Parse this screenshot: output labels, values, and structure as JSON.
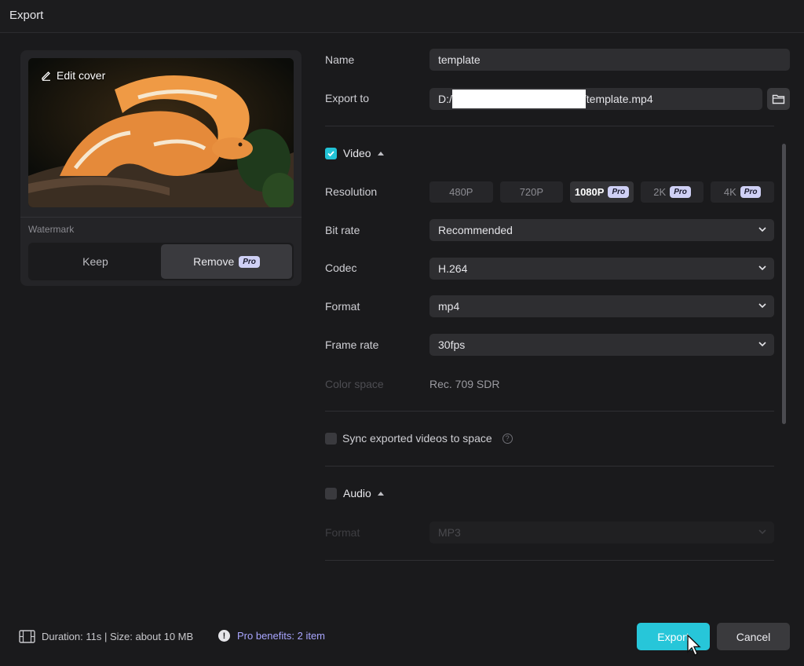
{
  "window": {
    "title": "Export"
  },
  "cover": {
    "edit_label": "Edit cover"
  },
  "watermark": {
    "label": "Watermark",
    "keep_label": "Keep",
    "remove_label": "Remove",
    "pro_badge": "Pro"
  },
  "form": {
    "name_label": "Name",
    "name_value": "template",
    "export_to_label": "Export to",
    "path_prefix": "D:/",
    "path_suffix": "/template.mp4"
  },
  "video": {
    "label": "Video",
    "enabled": true,
    "resolution_label": "Resolution",
    "resolutions": [
      {
        "label": "480P",
        "pro": ""
      },
      {
        "label": "720P",
        "pro": ""
      },
      {
        "label": "1080P",
        "pro": "Pro"
      },
      {
        "label": "2K",
        "pro": "Pro"
      },
      {
        "label": "4K",
        "pro": "Pro"
      }
    ],
    "selected_resolution": "1080P",
    "bitrate_label": "Bit rate",
    "bitrate_value": "Recommended",
    "codec_label": "Codec",
    "codec_value": "H.264",
    "format_label": "Format",
    "format_value": "mp4",
    "framerate_label": "Frame rate",
    "framerate_value": "30fps",
    "colorspace_label": "Color space",
    "colorspace_value": "Rec. 709 SDR"
  },
  "sync": {
    "label": "Sync exported videos to space",
    "help_icon": "?"
  },
  "audio": {
    "label": "Audio",
    "enabled": false,
    "format_label": "Format",
    "format_value": "MP3"
  },
  "footer": {
    "info": "Duration: 11s | Size: about 10 MB",
    "warn_icon": "!",
    "pro_benefits": "Pro benefits: 2 item",
    "export_label": "Export",
    "cancel_label": "Cancel"
  },
  "colors": {
    "accent": "#27c6d9",
    "pro_badge": "#cfd0f5",
    "pro_text": "#a9a6ff",
    "bg": "#1a1a1c"
  }
}
